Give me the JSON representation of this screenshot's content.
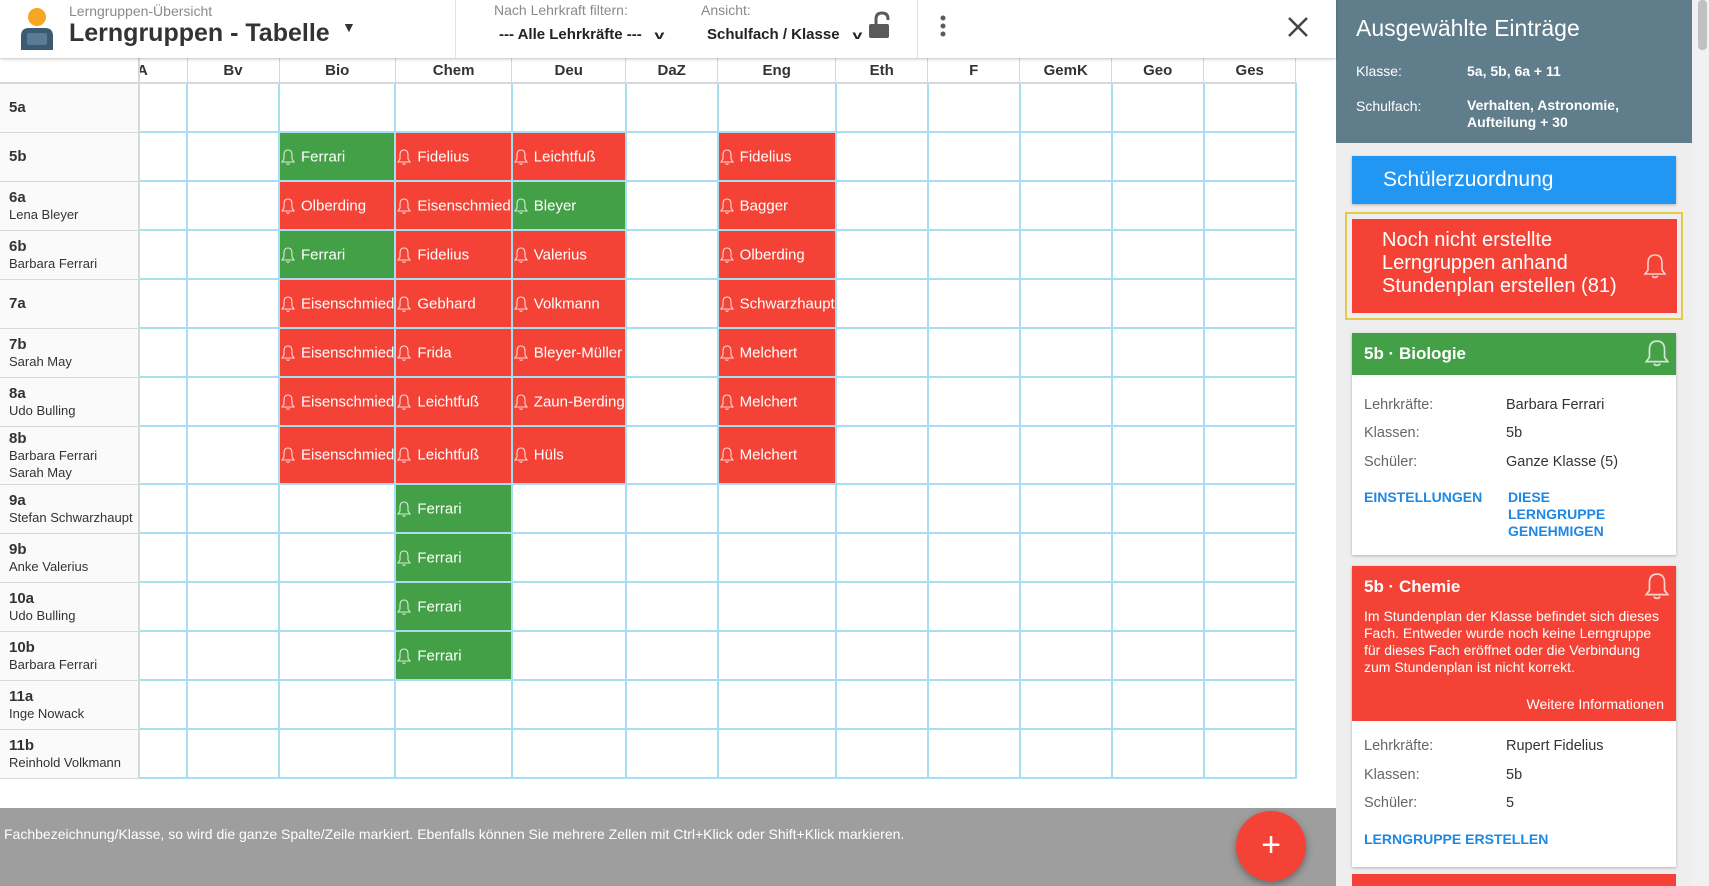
{
  "header": {
    "subtitle": "Lerngruppen-Übersicht",
    "title": "Lerngruppen - Tabelle",
    "filter_label": "Nach Lehrkraft filtern:",
    "filter_value": "--- Alle Lehrkräfte ---",
    "view_label": "Ansicht:",
    "view_value": "Schulfach / Klasse"
  },
  "table": {
    "columns": [
      "A",
      "Bv",
      "Bio",
      "Chem",
      "Deu",
      "DaZ",
      "Eng",
      "Eth",
      "F",
      "GemK",
      "Geo",
      "Ges"
    ],
    "rows": [
      {
        "class": "5a",
        "teachers": [],
        "cells": {}
      },
      {
        "class": "5b",
        "teachers": [],
        "cells": {
          "Bio": {
            "name": "Ferrari",
            "status": "green"
          },
          "Chem": {
            "name": "Fidelius",
            "status": "red"
          },
          "Deu": {
            "name": "Leichtfuß",
            "status": "red"
          },
          "Eng": {
            "name": "Fidelius",
            "status": "red"
          }
        }
      },
      {
        "class": "6a",
        "teachers": [
          "Lena Bleyer"
        ],
        "cells": {
          "Bio": {
            "name": "Olberding",
            "status": "red"
          },
          "Chem": {
            "name": "Eisenschmied",
            "status": "red"
          },
          "Deu": {
            "name": "Bleyer",
            "status": "green"
          },
          "Eng": {
            "name": "Bagger",
            "status": "red"
          }
        }
      },
      {
        "class": "6b",
        "teachers": [
          "Barbara Ferrari"
        ],
        "cells": {
          "Bio": {
            "name": "Ferrari",
            "status": "green"
          },
          "Chem": {
            "name": "Fidelius",
            "status": "red"
          },
          "Deu": {
            "name": "Valerius",
            "status": "red"
          },
          "Eng": {
            "name": "Olberding",
            "status": "red"
          }
        }
      },
      {
        "class": "7a",
        "teachers": [],
        "cells": {
          "Bio": {
            "name": "Eisenschmied",
            "status": "red"
          },
          "Chem": {
            "name": "Gebhard",
            "status": "red"
          },
          "Deu": {
            "name": "Volkmann",
            "status": "red"
          },
          "Eng": {
            "name": "Schwarzhaupt",
            "status": "red"
          }
        }
      },
      {
        "class": "7b",
        "teachers": [
          "Sarah May"
        ],
        "cells": {
          "Bio": {
            "name": "Eisenschmied",
            "status": "red"
          },
          "Chem": {
            "name": "Frida",
            "status": "red"
          },
          "Deu": {
            "name": "Bleyer-Müller",
            "status": "red"
          },
          "Eng": {
            "name": "Melchert",
            "status": "red"
          }
        }
      },
      {
        "class": "8a",
        "teachers": [
          "Udo Bulling"
        ],
        "cells": {
          "Bio": {
            "name": "Eisenschmied",
            "status": "red"
          },
          "Chem": {
            "name": "Leichtfuß",
            "status": "red"
          },
          "Deu": {
            "name": "Zaun-Berding",
            "status": "red"
          },
          "Eng": {
            "name": "Melchert",
            "status": "red"
          }
        }
      },
      {
        "class": "8b",
        "teachers": [
          "Barbara Ferrari",
          "Sarah May"
        ],
        "cells": {
          "Bio": {
            "name": "Eisenschmied",
            "status": "red"
          },
          "Chem": {
            "name": "Leichtfuß",
            "status": "red"
          },
          "Deu": {
            "name": "Hüls",
            "status": "red"
          },
          "Eng": {
            "name": "Melchert",
            "status": "red"
          }
        }
      },
      {
        "class": "9a",
        "teachers": [
          "Stefan Schwarzhaupt"
        ],
        "cells": {
          "Chem": {
            "name": "Ferrari",
            "status": "green"
          }
        }
      },
      {
        "class": "9b",
        "teachers": [
          "Anke Valerius"
        ],
        "cells": {
          "Chem": {
            "name": "Ferrari",
            "status": "green"
          }
        }
      },
      {
        "class": "10a",
        "teachers": [
          "Udo Bulling"
        ],
        "cells": {
          "Chem": {
            "name": "Ferrari",
            "status": "green"
          }
        }
      },
      {
        "class": "10b",
        "teachers": [
          "Barbara Ferrari"
        ],
        "cells": {
          "Chem": {
            "name": "Ferrari",
            "status": "green"
          }
        }
      },
      {
        "class": "11a",
        "teachers": [
          "Inge Nowack"
        ],
        "cells": {}
      },
      {
        "class": "11b",
        "teachers": [
          "Reinhold Volkmann"
        ],
        "cells": {}
      }
    ]
  },
  "footer": {
    "hint": "Fachbezeichnung/Klasse, so wird die ganze Spalte/Zeile markiert. Ebenfalls können Sie mehrere Zellen mit Ctrl+Klick oder Shift+Klick markieren.",
    "fab_label": "+"
  },
  "panel": {
    "title": "Ausgewählte Einträge",
    "classes_label": "Klasse:",
    "classes_value": "5a, 5b, 6a + 11",
    "subjects_label": "Schulfach:",
    "subjects_value": "Verhalten, Astronomie, Aufteilung + 30",
    "assign_button": "Schülerzuordnung",
    "alert_text": "Noch nicht erstellte Lerngruppen anhand Stundenplan erstellen (81)",
    "card_bio": {
      "title": "5b · Biologie",
      "teachers_label": "Lehrkräfte:",
      "teachers_value": "Barbara Ferrari",
      "classes_label": "Klassen:",
      "classes_value": "5b",
      "students_label": "Schüler:",
      "students_value": "Ganze Klasse (5)",
      "action_settings": "EINSTELLUNGEN",
      "action_approve": "DIESE LERNGRUPPE GENEHMIGEN"
    },
    "card_chem": {
      "title": "5b · Chemie",
      "message": "Im Stundenplan der Klasse befindet sich dieses Fach. Entweder wurde noch keine Lerngruppe für dieses Fach eröffnet oder die Verbindung zum Stundenplan ist nicht korrekt.",
      "more": "Weitere Informationen",
      "teachers_label": "Lehrkräfte:",
      "teachers_value": "Rupert Fidelius",
      "classes_label": "Klassen:",
      "classes_value": "5b",
      "students_label": "Schüler:",
      "students_value": "5",
      "action_create": "LERNGRUPPE ERSTELLEN"
    }
  },
  "colors": {
    "red": "#f44336",
    "green": "#43a047",
    "blue": "#2196f3",
    "panel_header": "#607d8b",
    "cell_border": "#a9ddf2",
    "highlight": "#e6c94b"
  },
  "icons": {
    "avatar": "user-avatar-icon",
    "lock": "lock-open-icon",
    "more": "more-vertical-icon",
    "close": "close-icon",
    "bell": "bell-icon",
    "add": "add-icon"
  }
}
